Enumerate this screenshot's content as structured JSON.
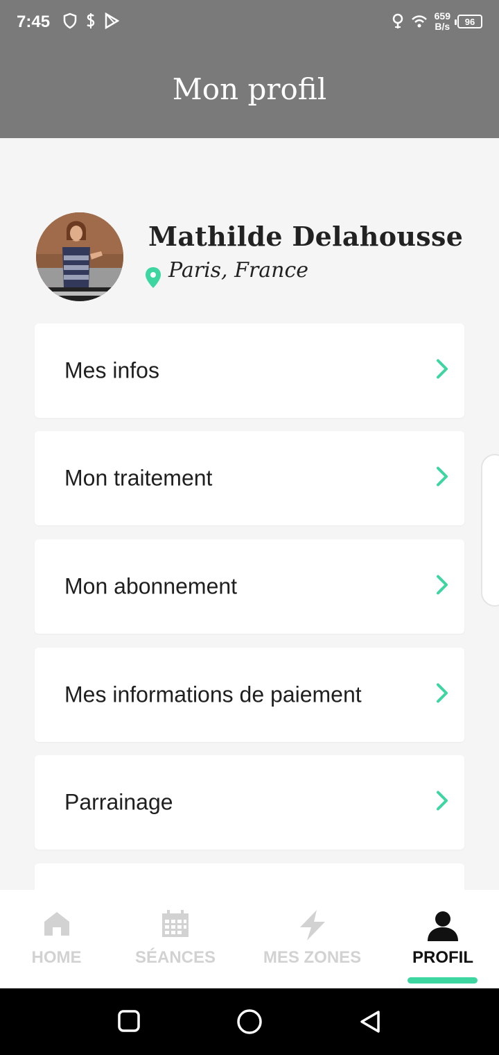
{
  "status_bar": {
    "time": "7:45",
    "net_speed_value": "659",
    "net_speed_unit": "B/s",
    "battery": "96"
  },
  "header": {
    "title": "Mon profil"
  },
  "profile": {
    "name": "Mathilde Delahousse",
    "location": "Paris, France"
  },
  "menu": {
    "items": [
      {
        "label": "Mes infos"
      },
      {
        "label": "Mon traitement"
      },
      {
        "label": "Mon abonnement"
      },
      {
        "label": "Mes informations de paiement"
      },
      {
        "label": "Parrainage"
      }
    ]
  },
  "bottom_nav": {
    "items": [
      {
        "label": "HOME",
        "icon": "home-icon"
      },
      {
        "label": "SÉANCES",
        "icon": "calendar-icon"
      },
      {
        "label": "MES ZONES",
        "icon": "lightning-icon"
      },
      {
        "label": "PROFIL",
        "icon": "user-icon",
        "active": true
      }
    ]
  },
  "colors": {
    "header": "#7a7a7a",
    "accent": "#3dd6a0",
    "inactive_nav": "#d2d2d2"
  }
}
